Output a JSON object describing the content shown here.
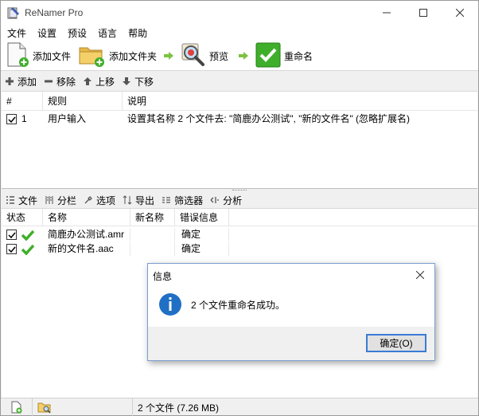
{
  "window": {
    "title": "ReNamer Pro"
  },
  "menu": [
    "文件",
    "设置",
    "预设",
    "语言",
    "帮助"
  ],
  "toolbar": {
    "add_files": "添加文件",
    "add_folders": "添加文件夹",
    "preview": "预览",
    "rename": "重命名"
  },
  "rules_toolbar": {
    "add": "添加",
    "remove": "移除",
    "up": "上移",
    "down": "下移"
  },
  "rules_table": {
    "columns": [
      "#",
      "规则",
      "说明"
    ],
    "rows": [
      {
        "checked": true,
        "index": "1",
        "rule": "用户输入",
        "description": "设置其名称 2 个文件去: \"简鹿办公测试\", \"新的文件名\" (忽略扩展名)"
      }
    ]
  },
  "files_toolbar": {
    "files": "文件",
    "columns": "分栏",
    "options": "选项",
    "export": "导出",
    "filters": "筛选器",
    "analyze": "分析"
  },
  "files_table": {
    "columns": [
      "状态",
      "名称",
      "新名称",
      "错误信息"
    ],
    "rows": [
      {
        "checked": true,
        "name": "简鹿办公测试.amr",
        "new_name": "",
        "error": "确定"
      },
      {
        "checked": true,
        "name": "新的文件名.aac",
        "new_name": "",
        "error": "确定"
      }
    ]
  },
  "statusbar": {
    "summary": "2 个文件 (7.26 MB)"
  },
  "dialog": {
    "title": "信息",
    "message": "2 个文件重命名成功。",
    "ok_button": "确定(O)"
  },
  "colors": {
    "accent": "#3a7bd5",
    "check_green": "#3fae2a",
    "info_blue": "#1f6fc5"
  }
}
